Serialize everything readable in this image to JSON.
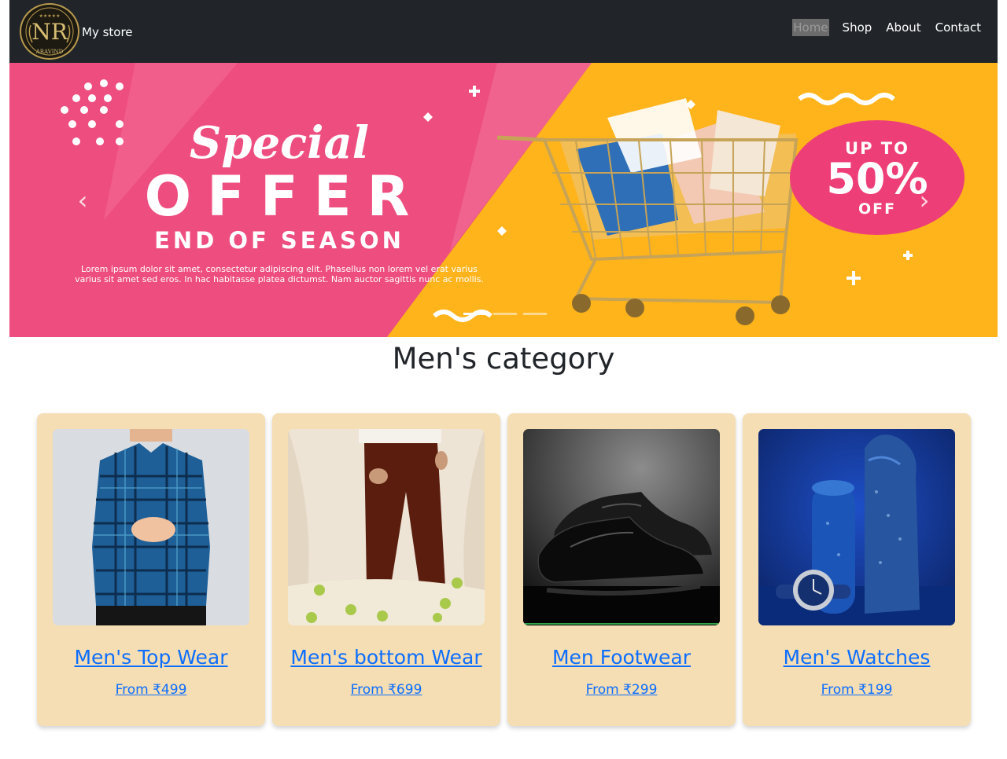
{
  "navbar": {
    "brand": "My store",
    "logo_text": "NR",
    "logo_subtext": "ARAVIND",
    "links": [
      {
        "label": "Home",
        "active": true
      },
      {
        "label": "Shop",
        "active": false
      },
      {
        "label": "About",
        "active": false
      },
      {
        "label": "Contact",
        "active": false
      }
    ]
  },
  "hero": {
    "script_title": "Special",
    "big_title": "OFFER",
    "subtitle": "END OF SEASON",
    "body": "Lorem ipsum dolor sit amet, consectetur adipiscing elit. Phasellus non lorem vel erat varius varius sit amet sed eros. In hac habitasse platea dictumst. Nam auctor sagittis nunc ac mollis.",
    "badge": {
      "up_to": "UP TO",
      "percent": "50%",
      "off": "OFF"
    },
    "indicator_count": 3,
    "active_slide": 1,
    "colors": {
      "pink": "#ee4d7f",
      "yellow": "#ffb41c"
    }
  },
  "category": {
    "title": "Men's category",
    "cards": [
      {
        "title": "Men's Top Wear",
        "price": "From ₹499",
        "image": "checked-shirt-photo"
      },
      {
        "title": "Men's bottom Wear",
        "price": "From ₹699",
        "image": "brown-trousers-photo"
      },
      {
        "title": "Men Footwear",
        "price": "From ₹299",
        "image": "black-leather-shoes-photo"
      },
      {
        "title": "Men's Watches",
        "price": "From ₹199",
        "image": "blue-watch-perfume-photo"
      }
    ]
  },
  "colors": {
    "navbar_bg": "#212529",
    "card_bg": "#f5deb3",
    "link": "#0d6efd"
  }
}
